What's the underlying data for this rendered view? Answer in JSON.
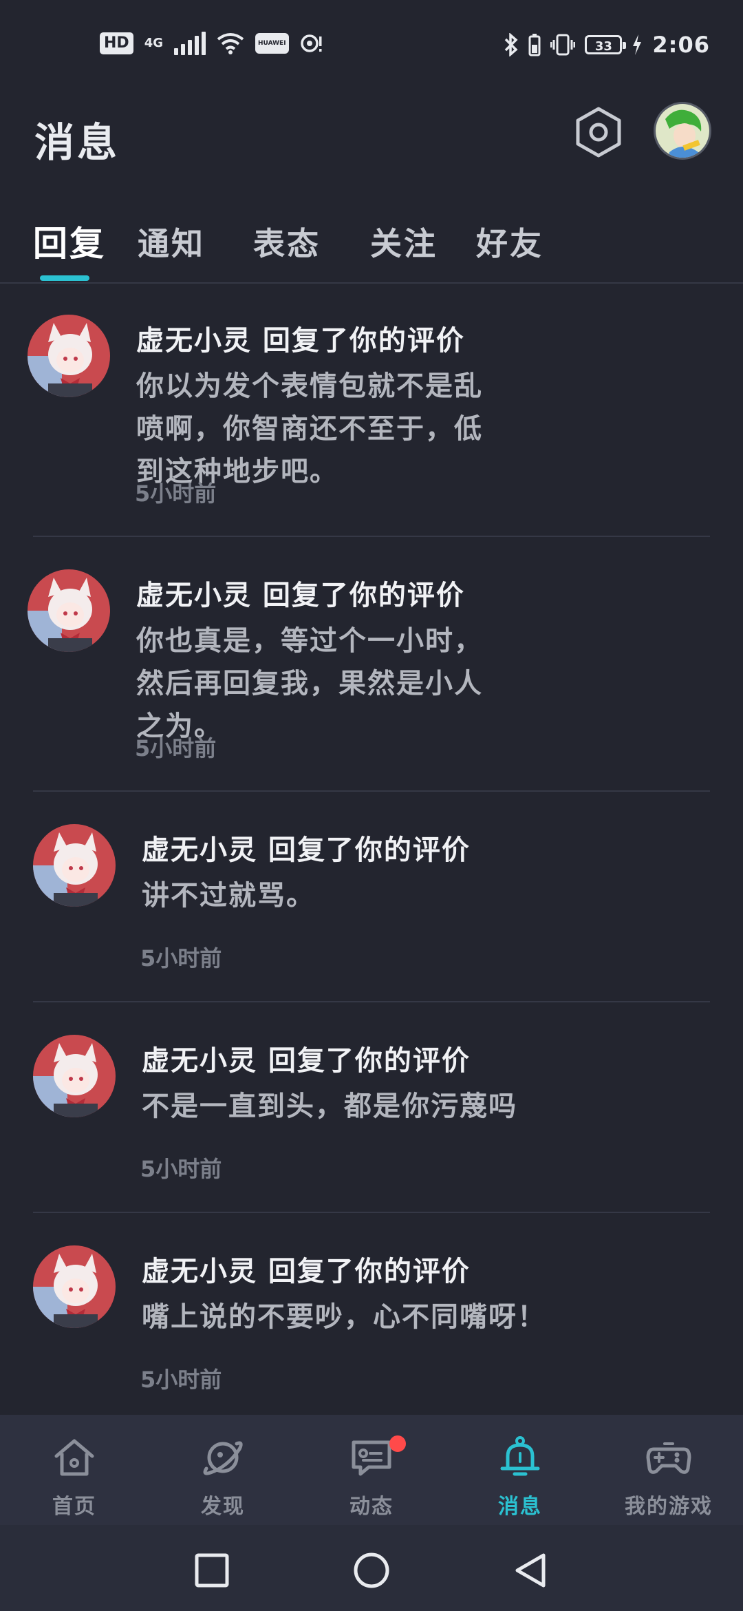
{
  "status_bar": {
    "hd": "HD",
    "network": "4G",
    "huawei": "HUAWEI",
    "battery": "33",
    "time": "2:06"
  },
  "header": {
    "title": "消息",
    "settings_icon": "settings-hexagon-icon",
    "avatar_icon": "profile-avatar"
  },
  "tabs": [
    {
      "label": "回复",
      "active": true
    },
    {
      "label": "通知",
      "active": false
    },
    {
      "label": "表态",
      "active": false
    },
    {
      "label": "关注",
      "active": false
    },
    {
      "label": "好友",
      "active": false
    }
  ],
  "messages": [
    {
      "title": "虚无小灵 回复了你的评价",
      "body": "你以为发个表情包就不是乱喷啊，你智商还不至于，低到这种地步吧。",
      "time": "5小时前"
    },
    {
      "title": "虚无小灵 回复了你的评价",
      "body": "你也真是，等过个一小时，然后再回复我，果然是小人之为。",
      "time": "5小时前"
    },
    {
      "title": "虚无小灵 回复了你的评价",
      "body": "讲不过就骂。",
      "time": "5小时前"
    },
    {
      "title": "虚无小灵 回复了你的评价",
      "body": "不是一直到头，都是你污蔑吗",
      "time": "5小时前"
    },
    {
      "title": "虚无小灵 回复了你的评价",
      "body": "嘴上说的不要吵，心不同嘴呀！",
      "time": "5小时前"
    }
  ],
  "bottom_nav": [
    {
      "label": "首页",
      "icon": "home-icon",
      "active": false
    },
    {
      "label": "发现",
      "icon": "planet-icon",
      "active": false
    },
    {
      "label": "动态",
      "icon": "chat-icon",
      "active": false,
      "badge": true
    },
    {
      "label": "消息",
      "icon": "bell-icon",
      "active": true
    },
    {
      "label": "我的游戏",
      "icon": "gamepad-icon",
      "active": false
    }
  ],
  "colors": {
    "background": "#23252f",
    "accent": "#2bc1d1",
    "badge": "#ff4a4a"
  }
}
